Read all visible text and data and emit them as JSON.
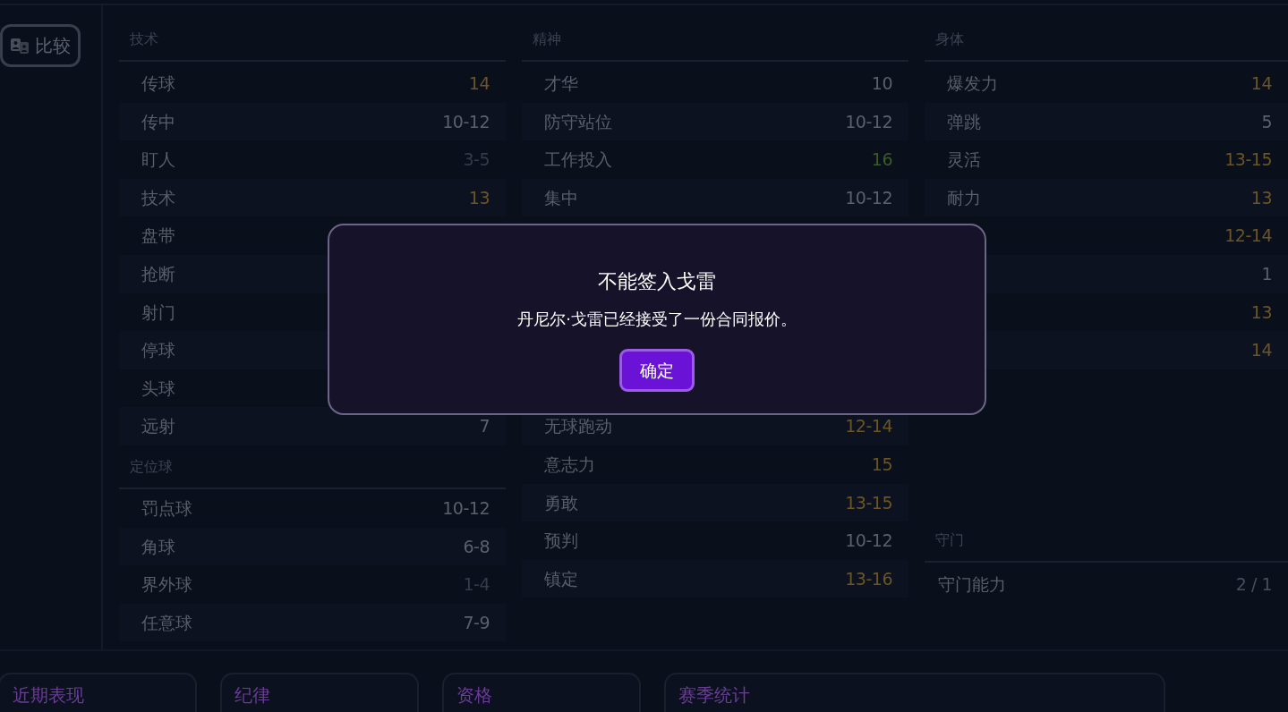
{
  "sidebar": {
    "compare_button": "比较"
  },
  "columns": [
    {
      "title": "技术",
      "rows": [
        {
          "label": "传球",
          "value": "14",
          "color": "#6b5526"
        },
        {
          "label": "传中",
          "value": "10-12",
          "color": "#5c606d"
        },
        {
          "label": "盯人",
          "value": "3-5",
          "color": "#363a4a"
        },
        {
          "label": "技术",
          "value": "13",
          "color": "#6b5526"
        },
        {
          "label": "盘带"
        },
        {
          "label": "抢断"
        },
        {
          "label": "射门"
        },
        {
          "label": "停球"
        },
        {
          "label": "头球"
        },
        {
          "label": "远射",
          "value": "7",
          "color": "#5c606d"
        }
      ],
      "sub_title": "定位球",
      "sub_rows": [
        {
          "label": "罚点球",
          "value": "10-12",
          "color": "#5c606d"
        },
        {
          "label": "角球",
          "value": "6-8",
          "color": "#5c606d"
        },
        {
          "label": "界外球",
          "value": "1-4",
          "color": "#363a4a"
        },
        {
          "label": "任意球",
          "value": "7-9",
          "color": "#5c606d"
        }
      ]
    },
    {
      "title": "精神",
      "rows": [
        {
          "label": "才华",
          "value": "10",
          "color": "#5c606d"
        },
        {
          "label": "防守站位",
          "value": "10-12",
          "color": "#5c606d"
        },
        {
          "label": "工作投入",
          "value": "16",
          "color": "#3b5c2a"
        },
        {
          "label": "集中",
          "value": "10-12",
          "color": "#5c606d"
        }
      ],
      "lower_rows": [
        {
          "label": "无球跑动",
          "value": "12-14",
          "color": "#6b5526"
        },
        {
          "label": "意志力",
          "value": "15",
          "color": "#6b5526"
        },
        {
          "label": "勇敢",
          "value": "13-15",
          "color": "#6b5526"
        },
        {
          "label": "预判",
          "value": "10-12",
          "color": "#5c606d"
        },
        {
          "label": "镇定",
          "value": "13-16",
          "color": "#6b5526"
        }
      ]
    },
    {
      "title": "身体",
      "rows": [
        {
          "label": "爆发力",
          "value": "14",
          "color": "#6b5526"
        },
        {
          "label": "弹跳",
          "value": "5",
          "color": "#5c606d"
        },
        {
          "label": "灵活",
          "value": "13-15",
          "color": "#6b5526"
        },
        {
          "label": "耐力",
          "value": "13",
          "color": "#6b5526"
        },
        {
          "value": "12-14",
          "color": "#6b5526"
        },
        {
          "value": "1",
          "color": "#5c606d"
        },
        {
          "value": "13",
          "color": "#6b5526"
        },
        {
          "value": "14",
          "color": "#6b5526"
        }
      ],
      "sub_title": "守门",
      "sub_rows": [
        {
          "label": "守门能力",
          "value": "2 / 1",
          "color": "#4a4e5c"
        }
      ]
    }
  ],
  "bottom_cards": [
    "近期表现",
    "纪律",
    "资格",
    "赛季统计"
  ],
  "dialog": {
    "title": "不能签入戈雷",
    "message": "丹尼尔·戈雷已经接受了一份合同报价。",
    "button": "确定"
  }
}
